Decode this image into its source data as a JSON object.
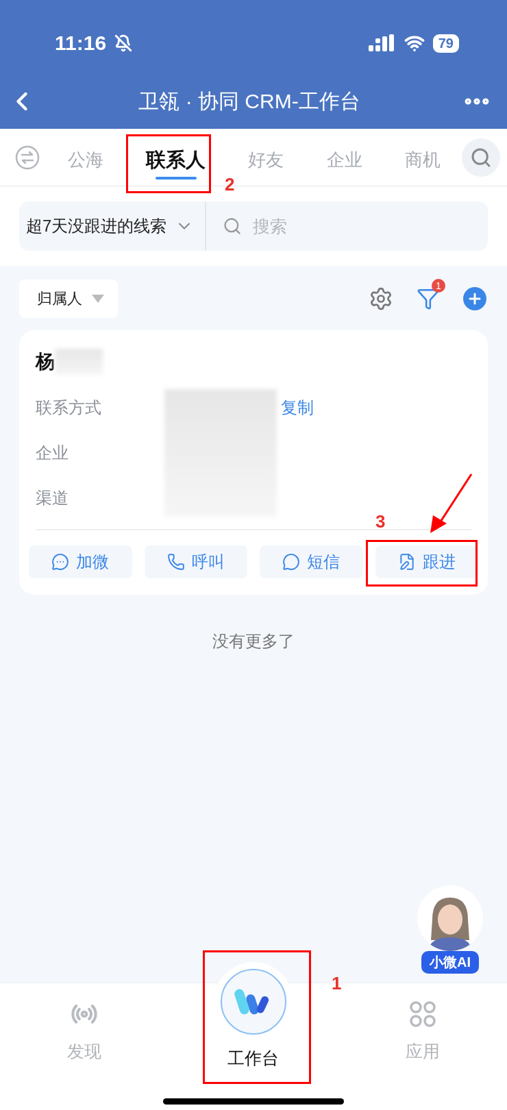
{
  "status_bar": {
    "time": "11:16",
    "battery": "79"
  },
  "nav_bar": {
    "title": "卫瓴 · 协同 CRM-工作台"
  },
  "tabs": [
    {
      "label": "公海",
      "selected": false
    },
    {
      "label": "联系人",
      "selected": true
    },
    {
      "label": "好友",
      "selected": false
    },
    {
      "label": "企业",
      "selected": false
    },
    {
      "label": "商机",
      "selected": false
    }
  ],
  "filter": {
    "dropdown": "超7天没跟进的线索",
    "placeholder": "搜索"
  },
  "toolbar": {
    "owner_filter": "归属人",
    "filter_badge": "1"
  },
  "contact_card": {
    "name": "杨",
    "fields": [
      {
        "label": "联系方式",
        "action": "复制"
      },
      {
        "label": "企业"
      },
      {
        "label": "渠道"
      }
    ],
    "actions": [
      {
        "kind": "wechat",
        "label": "加微"
      },
      {
        "kind": "call",
        "label": "呼叫"
      },
      {
        "kind": "sms",
        "label": "短信"
      },
      {
        "kind": "follow",
        "label": "跟进"
      }
    ]
  },
  "list_end": "没有更多了",
  "assistant": {
    "label": "小微AI"
  },
  "bottom_nav": [
    {
      "kind": "discover",
      "label": "发现",
      "selected": false
    },
    {
      "kind": "workbench",
      "label": "工作台",
      "selected": true
    },
    {
      "kind": "apps",
      "label": "应用",
      "selected": false
    }
  ],
  "annotations": [
    {
      "label": "1",
      "arrow": false
    },
    {
      "label": "2",
      "arrow": false
    },
    {
      "label": "3",
      "arrow": true
    }
  ]
}
